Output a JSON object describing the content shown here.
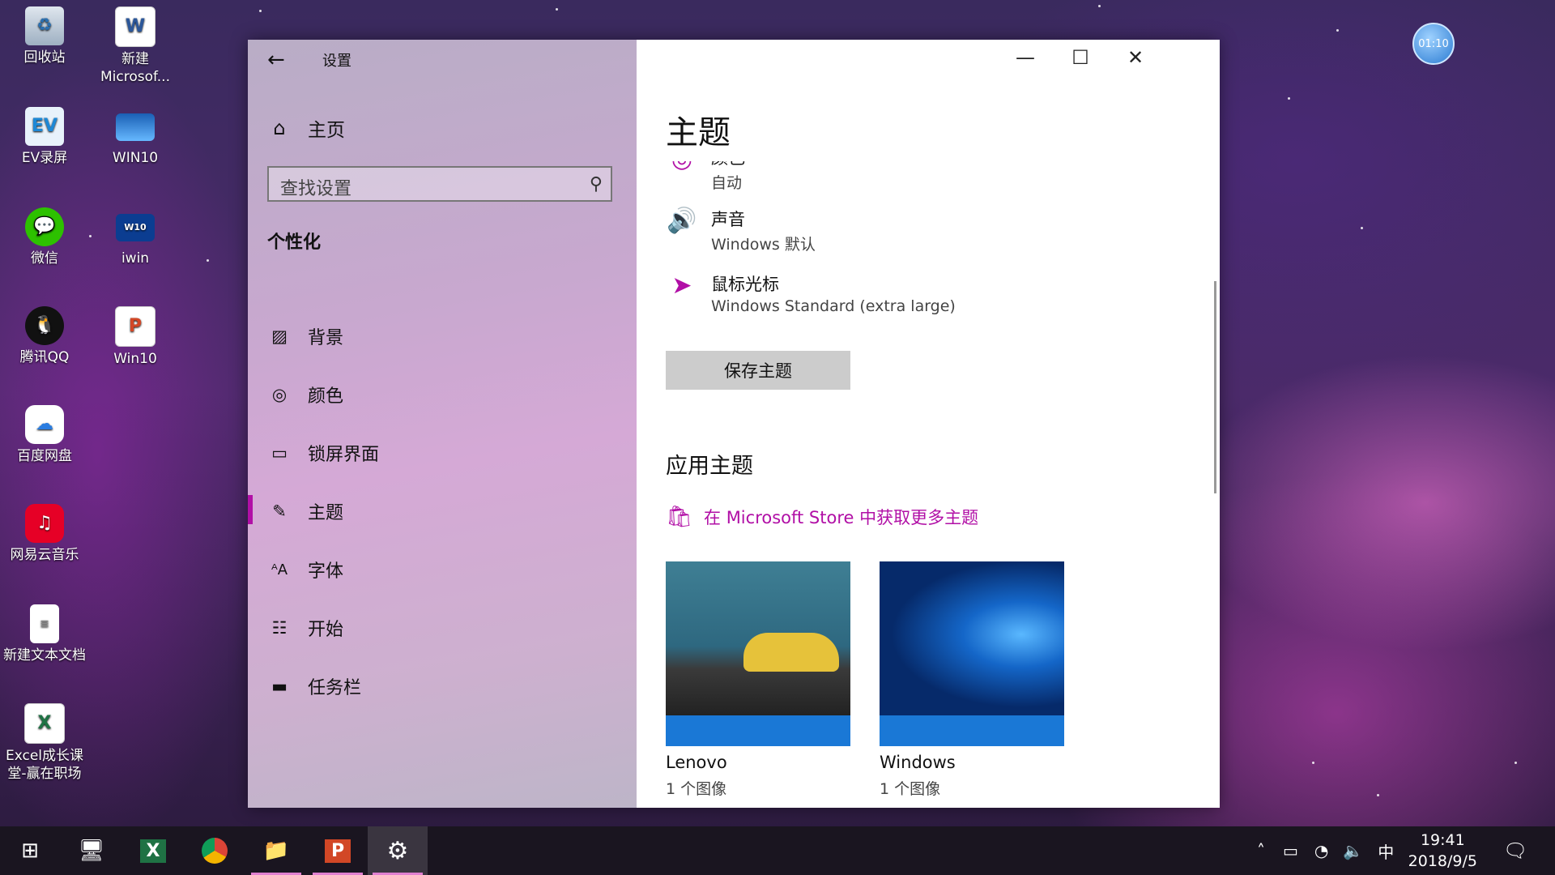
{
  "desktop": {
    "icons": [
      {
        "label": "回收站"
      },
      {
        "label": "新建\nMicrosof..."
      },
      {
        "label": "EV录屏"
      },
      {
        "label": "WIN10"
      },
      {
        "label": "微信"
      },
      {
        "label": "iwin"
      },
      {
        "label": "腾讯QQ"
      },
      {
        "label": "Win10"
      },
      {
        "label": "百度网盘"
      },
      {
        "label": "网易云音乐"
      },
      {
        "label": "新建文本文档"
      },
      {
        "label": "Excel成长课\n堂-赢在职场"
      }
    ],
    "timer_badge": "01:10"
  },
  "window": {
    "title": "设置",
    "nav": {
      "home": "主页",
      "search_placeholder": "查找设置",
      "section": "个性化",
      "items": [
        {
          "label": "背景"
        },
        {
          "label": "颜色"
        },
        {
          "label": "锁屏界面"
        },
        {
          "label": "主题"
        },
        {
          "label": "字体"
        },
        {
          "label": "开始"
        },
        {
          "label": "任务栏"
        }
      ],
      "selected": "主题"
    },
    "content": {
      "title": "主题",
      "settings": [
        {
          "name": "颜色",
          "value": "自动"
        },
        {
          "name": "声音",
          "value": "Windows 默认"
        },
        {
          "name": "鼠标光标",
          "value": "Windows Standard (extra large)"
        }
      ],
      "save_button": "保存主题",
      "apply_heading": "应用主题",
      "store_link": "在 Microsoft Store 中获取更多主题",
      "themes": [
        {
          "name": "Lenovo",
          "count": "1 个图像"
        },
        {
          "name": "Windows",
          "count": "1 个图像"
        }
      ]
    }
  },
  "taskbar": {
    "ime": "中",
    "time": "19:41",
    "date": "2018/9/5"
  },
  "colors": {
    "accent": "#b10fa6",
    "tile_blue": "#1a78d6",
    "taskbar": "#1a1520"
  }
}
